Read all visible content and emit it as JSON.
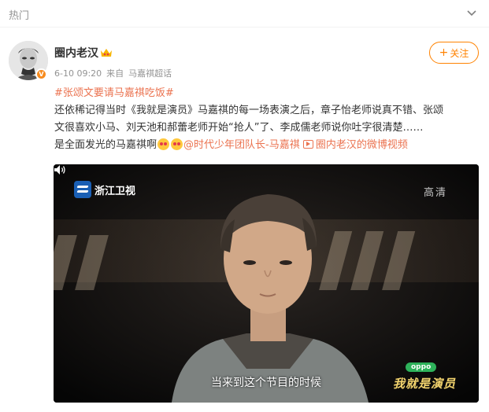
{
  "topbar": {
    "label": "热门"
  },
  "post": {
    "author": "圈内老汉",
    "avatar_badge": "V",
    "time": "6-10 09:20",
    "source_prefix": "来自",
    "source": "马嘉祺超话",
    "follow_label": "关注",
    "hashtag": "#张颂文要请马嘉祺吃饭#",
    "body_line1": "还依稀记得当时《我就是演员》马嘉祺的每一场表演之后，章子怡老师说真不错、张颂",
    "body_line2": "文很喜欢小马、刘天池和郝蕾老师开始“抢人”了、李成儒老师说你吐字很清楚……",
    "body_line3_text": "是全面发光的马嘉祺啊",
    "mention": "@时代少年团队长-马嘉祺",
    "video_link": "圈内老汉的微博视频"
  },
  "video": {
    "channel": "浙江卫视",
    "quality": "高清",
    "subtitle": "当来到这个节目的时候",
    "sponsor": "oppo",
    "show_logo": "我就是演员"
  },
  "colors": {
    "accent": "#ff8200",
    "link": "#eb7350",
    "meta": "#939393"
  }
}
